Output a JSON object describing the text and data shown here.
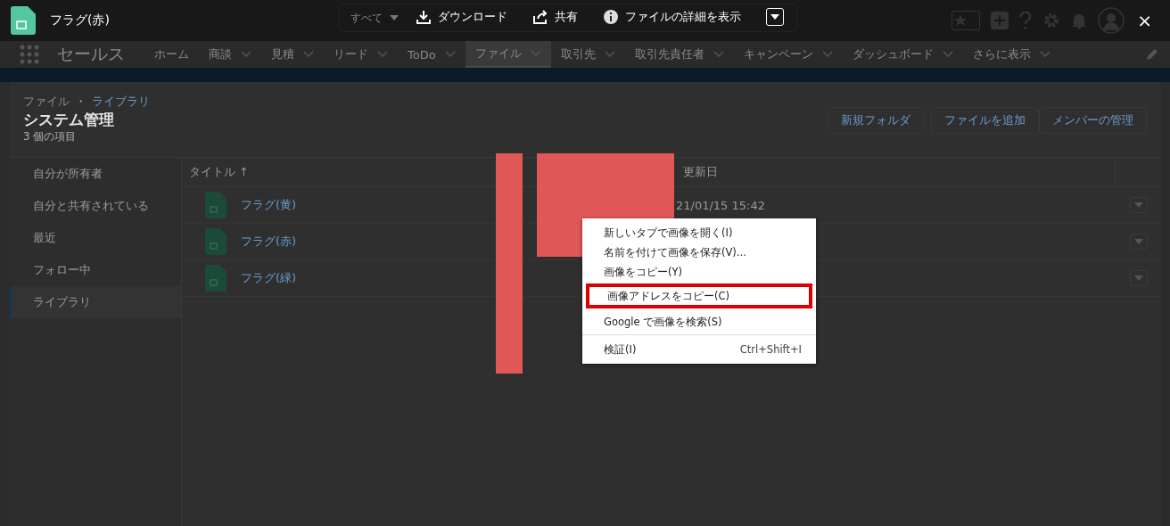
{
  "viewer": {
    "file_name": "フラグ(赤)",
    "close": "×",
    "actions": [
      {
        "kind": "download",
        "label": "ダウンロード"
      },
      {
        "kind": "share",
        "label": "共有"
      },
      {
        "kind": "info",
        "label": "ファイルの詳細を表示"
      },
      {
        "kind": "menu"
      }
    ]
  },
  "header": {
    "search_scope": "すべて",
    "app_name": "セールス"
  },
  "nav": [
    {
      "label": "ホーム",
      "menu": false,
      "selected": false
    },
    {
      "label": "商談",
      "menu": true,
      "selected": false
    },
    {
      "label": "見積",
      "menu": true,
      "selected": false
    },
    {
      "label": "リード",
      "menu": true,
      "selected": false
    },
    {
      "label": "ToDo",
      "menu": true,
      "selected": false
    },
    {
      "label": "ファイル",
      "menu": true,
      "selected": true
    },
    {
      "label": "取引先",
      "menu": true,
      "selected": false
    },
    {
      "label": "取引先責任者",
      "menu": true,
      "selected": false
    },
    {
      "label": "キャンペーン",
      "menu": true,
      "selected": false
    },
    {
      "label": "ダッシュボード",
      "menu": true,
      "selected": false
    },
    {
      "label": "さらに表示",
      "menu": true,
      "selected": false
    }
  ],
  "page": {
    "breadcrumb_root": "ファイル",
    "breadcrumb_separator": "・",
    "breadcrumb_link": "ライブラリ",
    "title": "システム管理",
    "count": "3 個の項目",
    "buttons": [
      "新規フォルダ",
      "ファイルを追加",
      "メンバーの管理"
    ]
  },
  "sidebar": [
    {
      "label": "自分が所有者",
      "selected": false
    },
    {
      "label": "自分と共有されている",
      "selected": false
    },
    {
      "label": "最近",
      "selected": false
    },
    {
      "label": "フォロー中",
      "selected": false
    },
    {
      "label": "ライブラリ",
      "selected": true
    }
  ],
  "table": {
    "columns": [
      "タイトル ↑",
      "更新日"
    ],
    "rows": [
      {
        "title": "フラグ(黄)",
        "date": "21/01/15 15:42"
      },
      {
        "title": "フラグ(赤)"
      },
      {
        "title": "フラグ(緑)"
      }
    ]
  },
  "context_menu": [
    {
      "label": "新しいタブで画像を開く(I)",
      "highlighted": false
    },
    {
      "label": "名前を付けて画像を保存(V)...",
      "highlighted": false
    },
    {
      "label": "画像をコピー(Y)",
      "highlighted": false
    },
    {
      "label": "画像アドレスをコピー(C)",
      "highlighted": true
    },
    {
      "label": "Google で画像を検索(S)",
      "highlighted": false,
      "separator_after": true
    },
    {
      "label": "検証(I)",
      "shortcut": "Ctrl+Shift+I",
      "highlighted": false
    }
  ]
}
